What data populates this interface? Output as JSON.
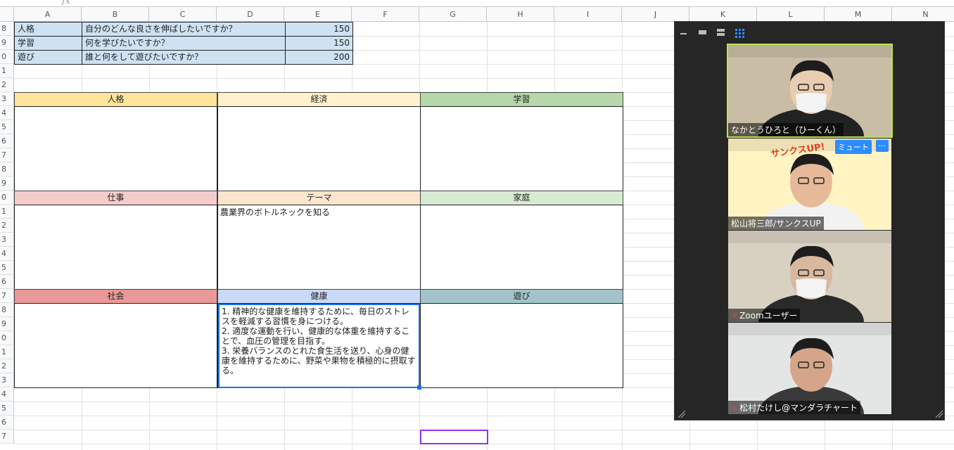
{
  "columns": [
    "A",
    "B",
    "C",
    "D",
    "E",
    "F",
    "G",
    "H",
    "I",
    "J",
    "K",
    "L",
    "M",
    "N"
  ],
  "row_numbers": [
    "8",
    "9",
    "0",
    "1",
    "2",
    "3",
    "4",
    "5",
    "6",
    "7",
    "8",
    "9",
    "0",
    "1",
    "2",
    "3",
    "4",
    "5",
    "6",
    "7",
    "8",
    "9",
    "0",
    "1",
    "2",
    "3",
    "4",
    "5",
    "6",
    "7"
  ],
  "top_rows": [
    {
      "category": "人格",
      "question": "自分のどんな良さを伸ばしたいですか？",
      "value": "150"
    },
    {
      "category": "学習",
      "question": "何を学びたいですか？",
      "value": "150"
    },
    {
      "category": "遊び",
      "question": "誰と何をして遊びたいですか？",
      "value": "200"
    }
  ],
  "mandala": {
    "row1": [
      {
        "label": "人格",
        "color": "#ffe599"
      },
      {
        "label": "経済",
        "color": "#fff2cc"
      },
      {
        "label": "学習",
        "color": "#b6d7a8"
      }
    ],
    "row2": [
      {
        "label": "仕事",
        "color": "#f4cccc"
      },
      {
        "label": "テーマ",
        "color": "#fce5cd"
      },
      {
        "label": "家庭",
        "color": "#d9ead3"
      }
    ],
    "row3": [
      {
        "label": "社会",
        "color": "#ea9999"
      },
      {
        "label": "健康",
        "color": "#c9daf8"
      },
      {
        "label": "遊び",
        "color": "#a2c4c9"
      }
    ],
    "theme_text": "農業界のボトルネックを知る",
    "health_text": "1. 精神的な健康を維持するために、毎日のストレスを軽減する習慣を身につける。\n2. 適度な運動を行い、健康的な体重を維持することで、血圧の管理を目指す。\n3. 栄養バランスのとれた食生活を送り、心身の健康を維持するために、野菜や果物を積極的に摂取する。"
  },
  "formula": {
    "fx_symbol": "fx"
  },
  "zoom": {
    "participants": [
      {
        "name": "なかとうひろと（ひーくん）",
        "muted": false,
        "bg": "#c9bda5",
        "skin": "#e8cdb0",
        "shirt": "#222222",
        "mask": true
      },
      {
        "name": "松山将三郎/サンクスUP",
        "muted": false,
        "bg": "#fff4c2",
        "skin": "#e6b999",
        "shirt": "#f2f2f2",
        "mask": false
      },
      {
        "name": "Zoomユーザー",
        "muted": true,
        "bg": "#d8d1c2",
        "skin": "#d9b8a0",
        "shirt": "#2a2a2a",
        "mask": true
      },
      {
        "name": "松村たけし@マンダラチャート",
        "muted": true,
        "bg": "#e3e6e4",
        "skin": "#d4a589",
        "shirt": "#3a3a3a",
        "mask": false
      }
    ],
    "mute_button": "ミュート",
    "more_button": "···",
    "banner": "サンクスUP!"
  },
  "colors": {
    "selection": "#1a73e8",
    "purple_select": "#9334e6"
  }
}
